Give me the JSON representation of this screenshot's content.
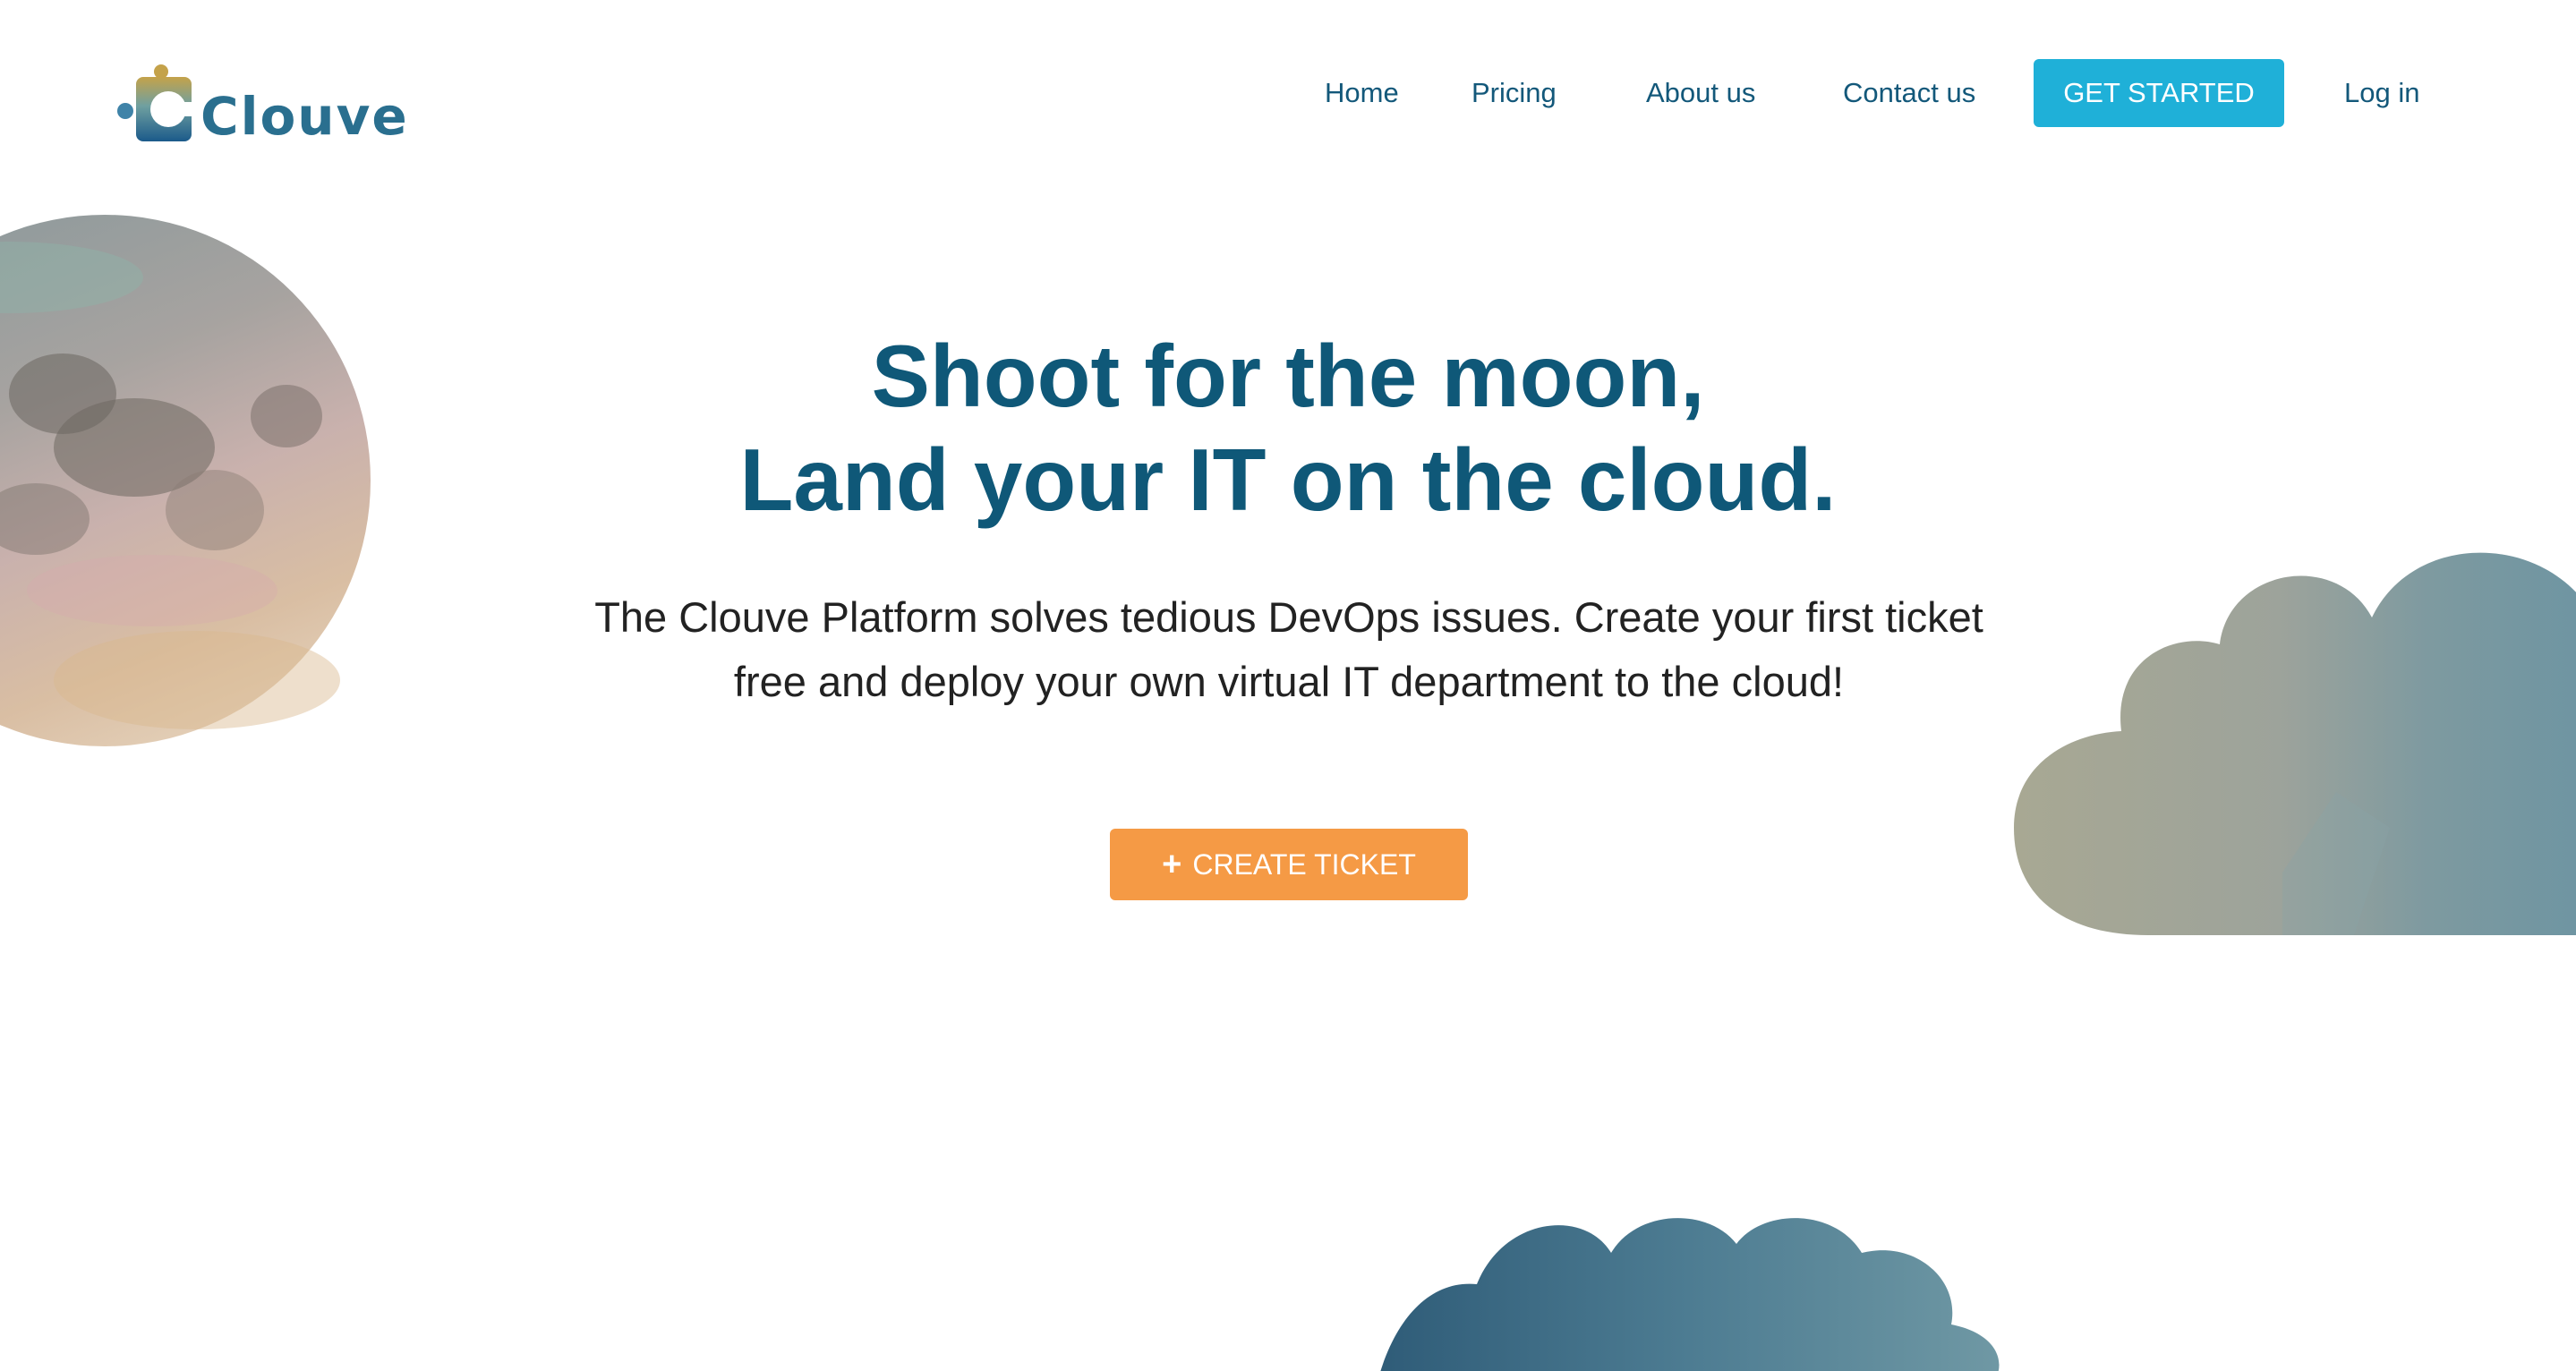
{
  "brand": {
    "name": "Clouve",
    "logo_icon": "puzzle-cloud-logo-icon",
    "colors": {
      "primary": "#0f5878",
      "accent": "#1fb0d8",
      "cta": "#f59a45"
    }
  },
  "nav": {
    "home": "Home",
    "pricing": "Pricing",
    "about": "About us",
    "contact": "Contact us",
    "get_started": "GET STARTED",
    "login": "Log in"
  },
  "hero": {
    "title_line1": "Shoot for the moon,",
    "title_line2": "Land your IT on the cloud.",
    "subtitle": "The Clouve Platform solves tedious DevOps issues. Create your first ticket free and deploy your own virtual IT department to the cloud!",
    "cta_icon": "+",
    "cta_label": "CREATE TICKET"
  },
  "decor": {
    "moon": "moon-illustration",
    "cloud_right": "cloud-illustration",
    "cloud_bottom": "cloud-illustration"
  }
}
